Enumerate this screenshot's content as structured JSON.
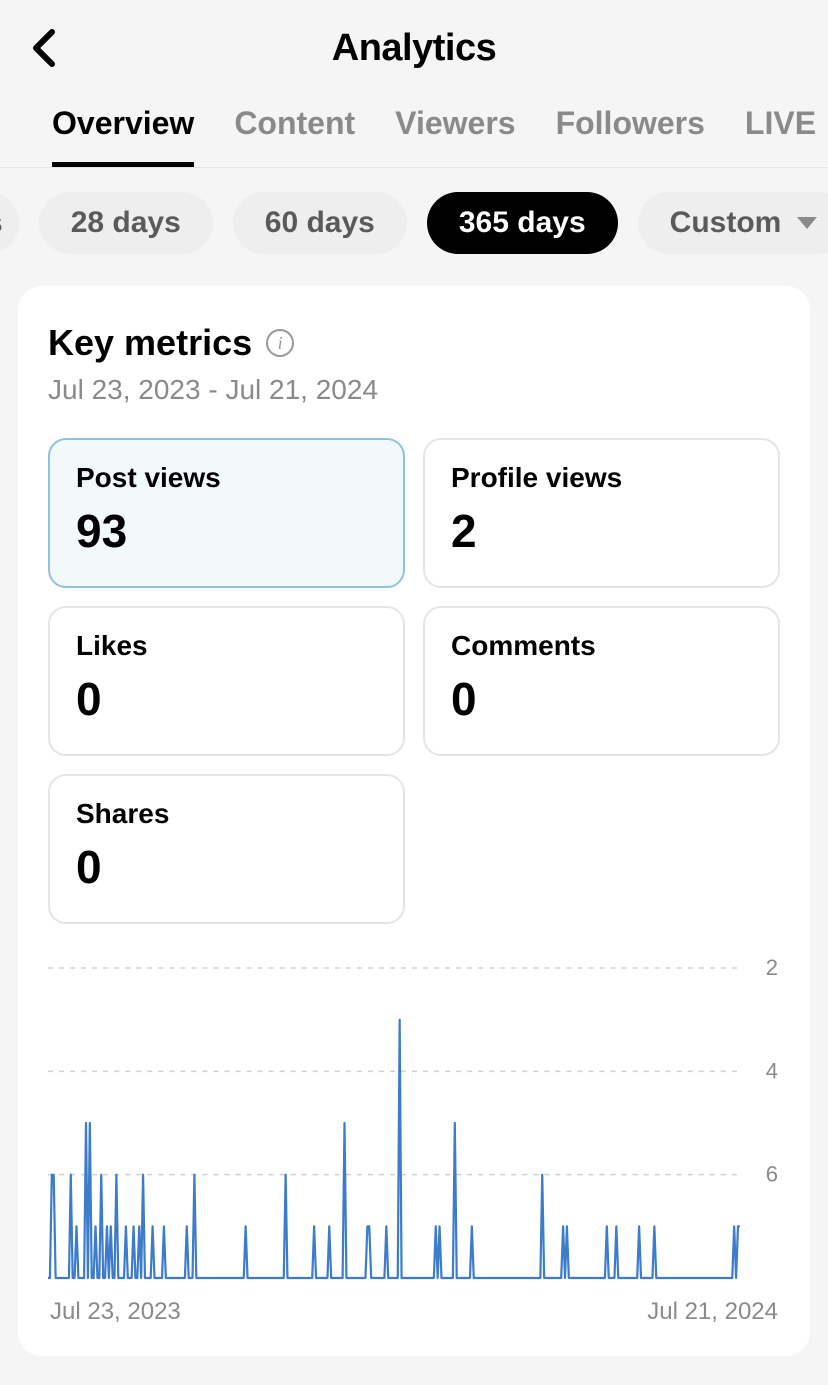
{
  "header": {
    "title": "Analytics"
  },
  "tabs": [
    {
      "label": "Overview",
      "active": true
    },
    {
      "label": "Content",
      "active": false
    },
    {
      "label": "Viewers",
      "active": false
    },
    {
      "label": "Followers",
      "active": false
    },
    {
      "label": "LIVE",
      "active": false
    }
  ],
  "ranges": {
    "partial_left": "s",
    "items": [
      {
        "label": "28 days",
        "active": false
      },
      {
        "label": "60 days",
        "active": false
      },
      {
        "label": "365 days",
        "active": true
      },
      {
        "label": "Custom",
        "active": false,
        "dropdown": true
      }
    ]
  },
  "key_metrics": {
    "title": "Key metrics",
    "date_range": "Jul 23, 2023 - Jul 21, 2024",
    "cards": [
      {
        "label": "Post views",
        "value": "93",
        "selected": true
      },
      {
        "label": "Profile views",
        "value": "2",
        "selected": false
      },
      {
        "label": "Likes",
        "value": "0",
        "selected": false
      },
      {
        "label": "Comments",
        "value": "0",
        "selected": false
      },
      {
        "label": "Shares",
        "value": "0",
        "selected": false
      }
    ]
  },
  "chart": {
    "x_start_label": "Jul 23, 2023",
    "x_end_label": "Jul 21, 2024",
    "y_ticks": [
      "6",
      "4",
      "2"
    ],
    "stroke": "#3d7ccc"
  },
  "chart_data": {
    "type": "line",
    "title": "Post views",
    "xlabel": "",
    "ylabel": "",
    "x_start": "Jul 23, 2023",
    "x_end": "Jul 21, 2024",
    "ylim": [
      0,
      6
    ],
    "y_ticks": [
      2,
      4,
      6
    ],
    "n_days": 365,
    "values": [
      0,
      0,
      2,
      2,
      0,
      0,
      0,
      0,
      0,
      0,
      0,
      0,
      2,
      0,
      0,
      1,
      0,
      0,
      0,
      0,
      3,
      0,
      3,
      0,
      0,
      1,
      0,
      0,
      2,
      0,
      0,
      1,
      0,
      1,
      0,
      0,
      2,
      0,
      0,
      0,
      0,
      1,
      0,
      0,
      0,
      1,
      0,
      0,
      1,
      0,
      2,
      0,
      0,
      0,
      0,
      1,
      0,
      0,
      0,
      0,
      0,
      1,
      0,
      0,
      0,
      0,
      0,
      0,
      0,
      0,
      0,
      0,
      0,
      1,
      0,
      0,
      0,
      2,
      0,
      0,
      0,
      0,
      0,
      0,
      0,
      0,
      0,
      0,
      0,
      0,
      0,
      0,
      0,
      0,
      0,
      0,
      0,
      0,
      0,
      0,
      0,
      0,
      0,
      0,
      1,
      0,
      0,
      0,
      0,
      0,
      0,
      0,
      0,
      0,
      0,
      0,
      0,
      0,
      0,
      0,
      0,
      0,
      0,
      0,
      0,
      2,
      0,
      0,
      0,
      0,
      0,
      0,
      0,
      0,
      0,
      0,
      0,
      0,
      0,
      0,
      1,
      0,
      0,
      0,
      0,
      0,
      0,
      0,
      1,
      0,
      0,
      0,
      0,
      0,
      0,
      0,
      3,
      0,
      0,
      0,
      0,
      0,
      0,
      0,
      0,
      0,
      0,
      0,
      1,
      1,
      0,
      0,
      0,
      0,
      0,
      0,
      0,
      0,
      1,
      0,
      0,
      0,
      0,
      0,
      0,
      5,
      0,
      0,
      0,
      0,
      0,
      0,
      0,
      0,
      0,
      0,
      0,
      0,
      0,
      0,
      0,
      0,
      0,
      0,
      1,
      0,
      1,
      0,
      0,
      0,
      0,
      0,
      0,
      0,
      3,
      0,
      0,
      0,
      0,
      0,
      0,
      0,
      0,
      1,
      0,
      0,
      0,
      0,
      0,
      0,
      0,
      0,
      0,
      0,
      0,
      0,
      0,
      0,
      0,
      0,
      0,
      0,
      0,
      0,
      0,
      0,
      0,
      0,
      0,
      0,
      0,
      0,
      0,
      0,
      0,
      0,
      0,
      0,
      0,
      0,
      2,
      0,
      0,
      0,
      0,
      0,
      0,
      0,
      0,
      0,
      0,
      1,
      0,
      1,
      0,
      0,
      0,
      0,
      0,
      0,
      0,
      0,
      0,
      0,
      0,
      0,
      0,
      0,
      0,
      0,
      0,
      0,
      0,
      0,
      1,
      0,
      0,
      0,
      0,
      1,
      0,
      0,
      0,
      0,
      0,
      0,
      0,
      0,
      0,
      0,
      0,
      1,
      0,
      0,
      0,
      0,
      0,
      0,
      0,
      1,
      0,
      0,
      0,
      0,
      0,
      0,
      0,
      0,
      0,
      0,
      0,
      0,
      0,
      0,
      0,
      0,
      0,
      0,
      0,
      0,
      0,
      0,
      0,
      0,
      0,
      0,
      0,
      0,
      0,
      0,
      0,
      0,
      0,
      0,
      0,
      0,
      0,
      0,
      0,
      0,
      0,
      1,
      0,
      1,
      1
    ]
  }
}
